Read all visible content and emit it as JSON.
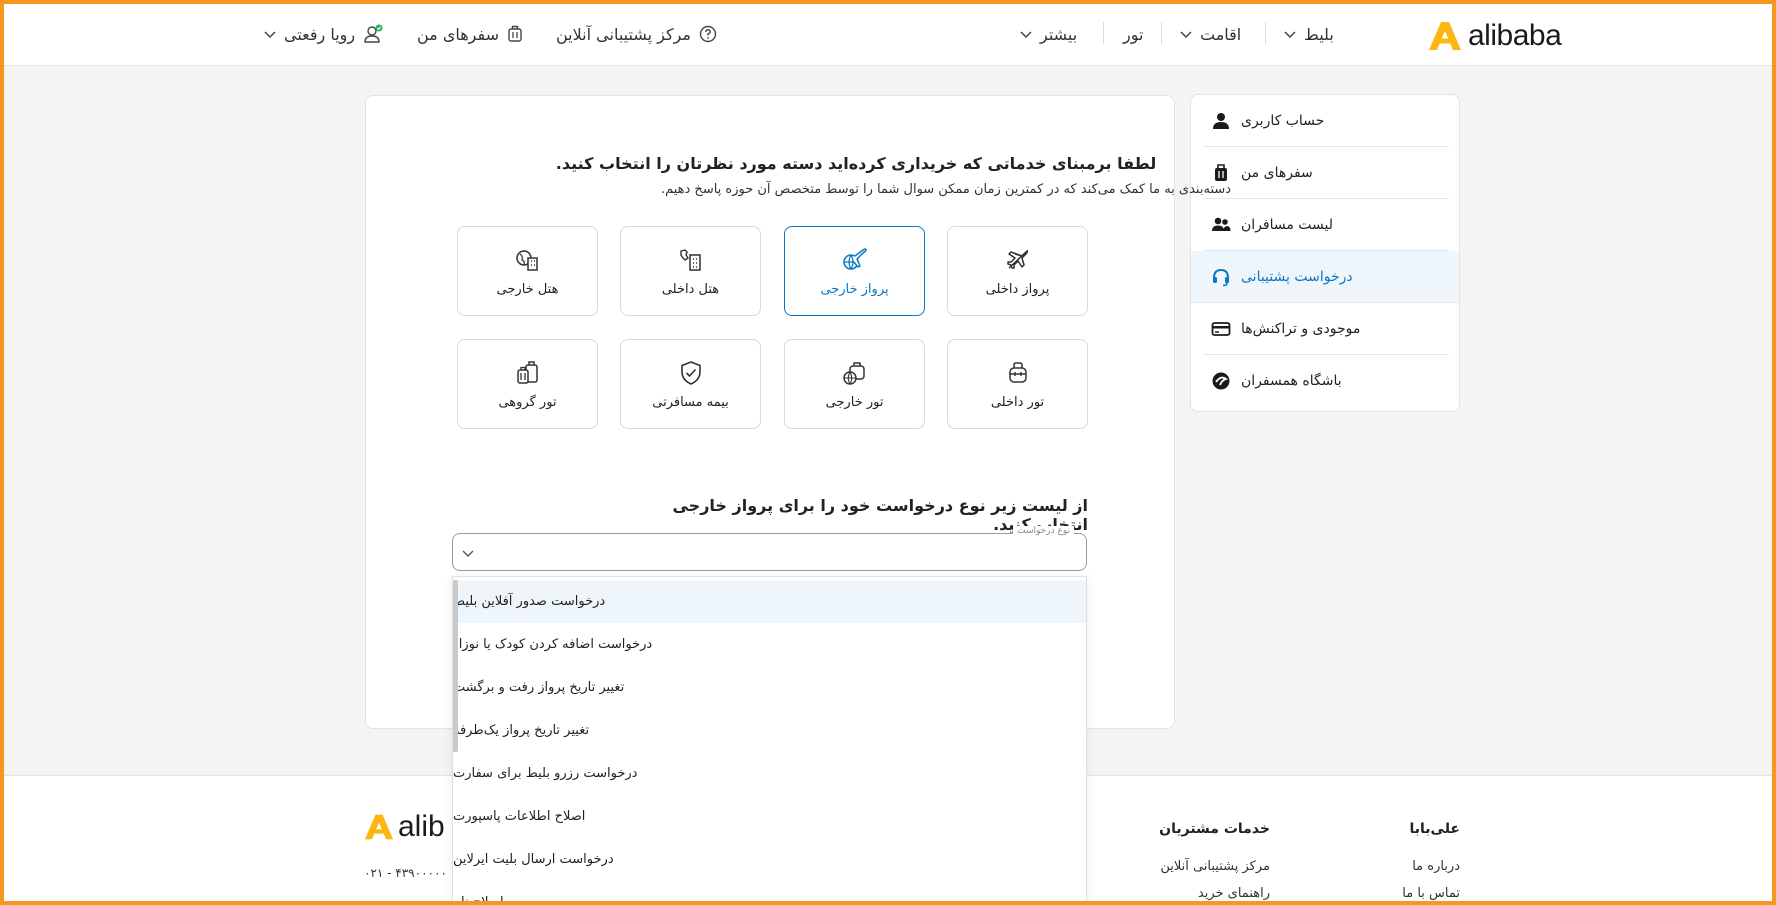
{
  "header": {
    "logo_text": "alibaba",
    "nav": [
      {
        "label": "بلیط"
      },
      {
        "label": "اقامت"
      },
      {
        "label": "تور"
      },
      {
        "label": "بیشتر"
      }
    ],
    "support_label": "مرکز پشتیبانی آنلاین",
    "trips_label": "سفرهای من",
    "user_label": "رویا رفعتی"
  },
  "sidebar": {
    "items": [
      {
        "label": "حساب کاربری",
        "icon": "user-icon"
      },
      {
        "label": "سفرهای من",
        "icon": "luggage-icon"
      },
      {
        "label": "لیست مسافران",
        "icon": "users-icon"
      },
      {
        "label": "درخواست پشتیبانی",
        "icon": "headset-icon",
        "active": true
      },
      {
        "label": "موجودی و تراکنش‌ها",
        "icon": "card-icon"
      },
      {
        "label": "باشگاه همسفران",
        "icon": "club-icon"
      }
    ]
  },
  "main": {
    "heading": "لطفا برمبنای خدماتی که خریداری کرده‌اید دسته مورد نظرتان را انتخاب کنید.",
    "subheading": "دسته‌بندی به ما کمک می‌کند که در کمترین زمان ممکن سوال شما را توسط متخصص آن حوزه پاسخ دهیم.",
    "categories": [
      {
        "label": "پرواز داخلی",
        "icon": "domestic-flight-icon"
      },
      {
        "label": "پرواز خارجی",
        "icon": "international-flight-icon",
        "selected": true
      },
      {
        "label": "هتل داخلی",
        "icon": "domestic-hotel-icon"
      },
      {
        "label": "هتل خارجی",
        "icon": "international-hotel-icon"
      },
      {
        "label": "تور داخلی",
        "icon": "domestic-tour-icon"
      },
      {
        "label": "تور خارجی",
        "icon": "international-tour-icon"
      },
      {
        "label": "بیمه مسافرتی",
        "icon": "insurance-shield-icon"
      },
      {
        "label": "تور گروهی",
        "icon": "group-tour-icon"
      }
    ],
    "request_prompt": "از لیست زیر نوع درخواست خود را برای پرواز خارجی انتخاب کنید.",
    "select": {
      "legend": "نوع درخواست",
      "value": ""
    },
    "dropdown_options": [
      "درخواست صدور آفلاین بلیط",
      "درخواست اضافه کردن کودک یا نوزاد",
      "تغییر تاریخ پرواز رفت و برگشت",
      "تغییر تاریخ پرواز یک‌طرفه",
      "درخواست رزرو بلیط برای سفارت",
      "اصلاح اطلاعات پاسپورت",
      "درخواست ارسال بلیت ایرلاین",
      "اصلاح نام"
    ]
  },
  "footer": {
    "logo_text": "alib",
    "phone": "۰۲۱ - ۴۳۹۰۰۰۰۰",
    "col_customer": {
      "title": "خدمات مشتریان",
      "links": [
        "مرکز پشتیبانی آنلاین",
        "راهنمای خرید"
      ]
    },
    "col_alibaba": {
      "title": "علی‌بابا",
      "links": [
        "درباره ما",
        "تماس با ما"
      ]
    }
  },
  "colors": {
    "accent": "#0b77c5",
    "brand": "#fdb713",
    "frame": "#f39a1e"
  }
}
